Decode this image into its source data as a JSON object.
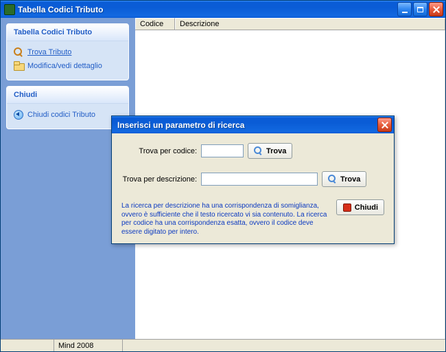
{
  "window": {
    "title": "Tabella Codici Tributo"
  },
  "sidebar": {
    "panel1": {
      "title": "Tabella Codici Tributo",
      "items": [
        {
          "label": "Trova Tributo",
          "active": true
        },
        {
          "label": "Modifica/vedi dettaglio"
        }
      ]
    },
    "panel2": {
      "title": "Chiudi",
      "items": [
        {
          "label": "Chiudi codici Tributo"
        }
      ]
    }
  },
  "grid": {
    "columns": {
      "codice": "Codice",
      "descrizione": "Descrizione"
    }
  },
  "statusbar": {
    "left": "",
    "app": "Mind 2008"
  },
  "dialog": {
    "title": "Inserisci un parametro di ricerca",
    "label_codice": "Trova per codice:",
    "label_descrizione": "Trova per descrizione:",
    "value_codice": "",
    "value_descrizione": "",
    "btn_trova": "Trova",
    "btn_chiudi": "Chiudi",
    "help": "La ricerca per descrizione ha una corrispondenza di somiglianza, ovvero è sufficiente che il testo ricercato vi sia contenuto. La ricerca per codice ha una corrispondenza esatta, ovvero il codice deve essere digitato per intero."
  }
}
